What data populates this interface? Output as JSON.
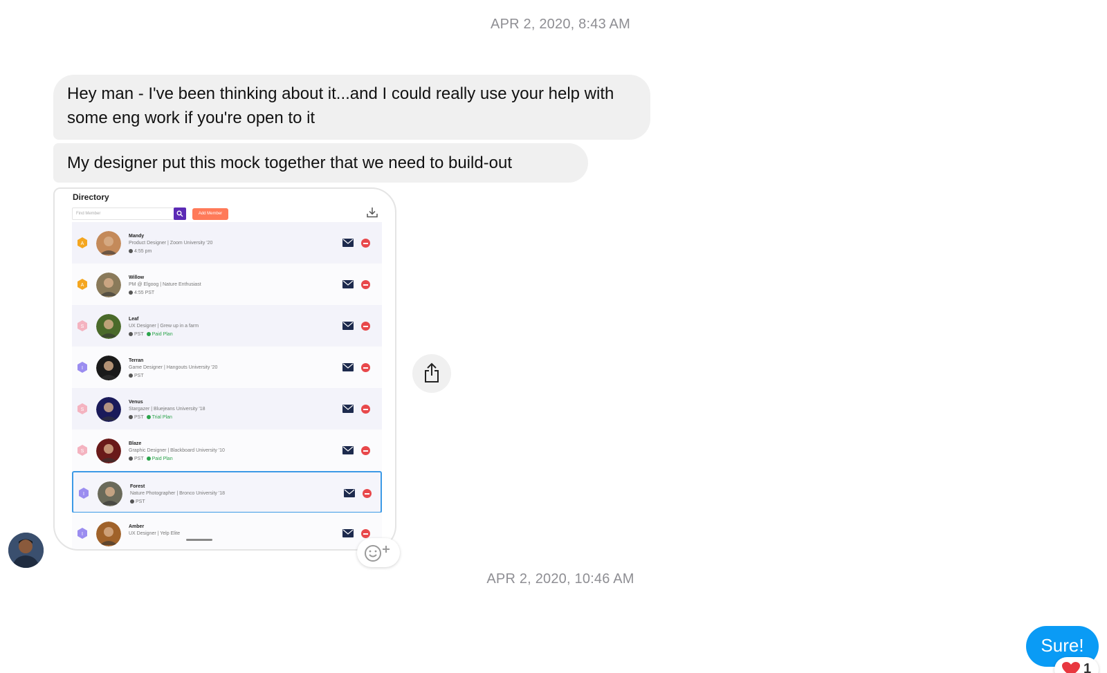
{
  "timestamps": [
    "APR 2, 2020, 8:43 AM",
    "APR 2, 2020, 10:46 AM"
  ],
  "messages": {
    "incoming": [
      "Hey man - I've been thinking about it...and I could really use your help with some eng work if you're open to it",
      "My designer put this mock together that we need to build-out"
    ],
    "outgoing": "Sure!"
  },
  "reaction": {
    "icon": "heart-icon",
    "count": "1",
    "color": "#e8373f"
  },
  "colors": {
    "outgoing_bubble": "#0a9bf5",
    "incoming_bubble": "#f0f0f0",
    "timestamp": "#8e8e93"
  },
  "mock": {
    "title": "Directory",
    "search_placeholder": "Find Member",
    "add_button": "Add Member",
    "members": [
      {
        "name": "Mandy",
        "subtitle": "Product Designer | Zoom University '20",
        "meta": "4:55 pm",
        "badge": "A",
        "badge_color": "#f4a620",
        "extra": ""
      },
      {
        "name": "Willow",
        "subtitle": "PM @ Elgoog | Nature Enthusiast",
        "meta": "4:55 PST",
        "badge": "A",
        "badge_color": "#f4a620",
        "extra": ""
      },
      {
        "name": "Leaf",
        "subtitle": "UX Designer | Grew up in a farm",
        "meta": "PST",
        "badge": "S",
        "badge_color": "#f4b3c0",
        "extra": "Paid Plan"
      },
      {
        "name": "Terran",
        "subtitle": "Game Designer | Hangouts University '20",
        "meta": "PST",
        "badge": "I",
        "badge_color": "#9b8df0",
        "extra": ""
      },
      {
        "name": "Venus",
        "subtitle": "Stargazer | Bluejeans University '18",
        "meta": "PST",
        "badge": "S",
        "badge_color": "#f4b3c0",
        "extra": "Trial Plan"
      },
      {
        "name": "Blaze",
        "subtitle": "Graphic Designer | Blackboard University '10",
        "meta": "PST",
        "badge": "S",
        "badge_color": "#f4b3c0",
        "extra": "Paid Plan"
      },
      {
        "name": "Forest",
        "subtitle": "Nature Photographer | Bronco University '18",
        "meta": "PST",
        "badge": "I",
        "badge_color": "#9b8df0",
        "extra": ""
      },
      {
        "name": "Amber",
        "subtitle": "UX Designer | Yelp Elite",
        "meta": "",
        "badge": "I",
        "badge_color": "#9b8df0",
        "extra": ""
      }
    ]
  }
}
